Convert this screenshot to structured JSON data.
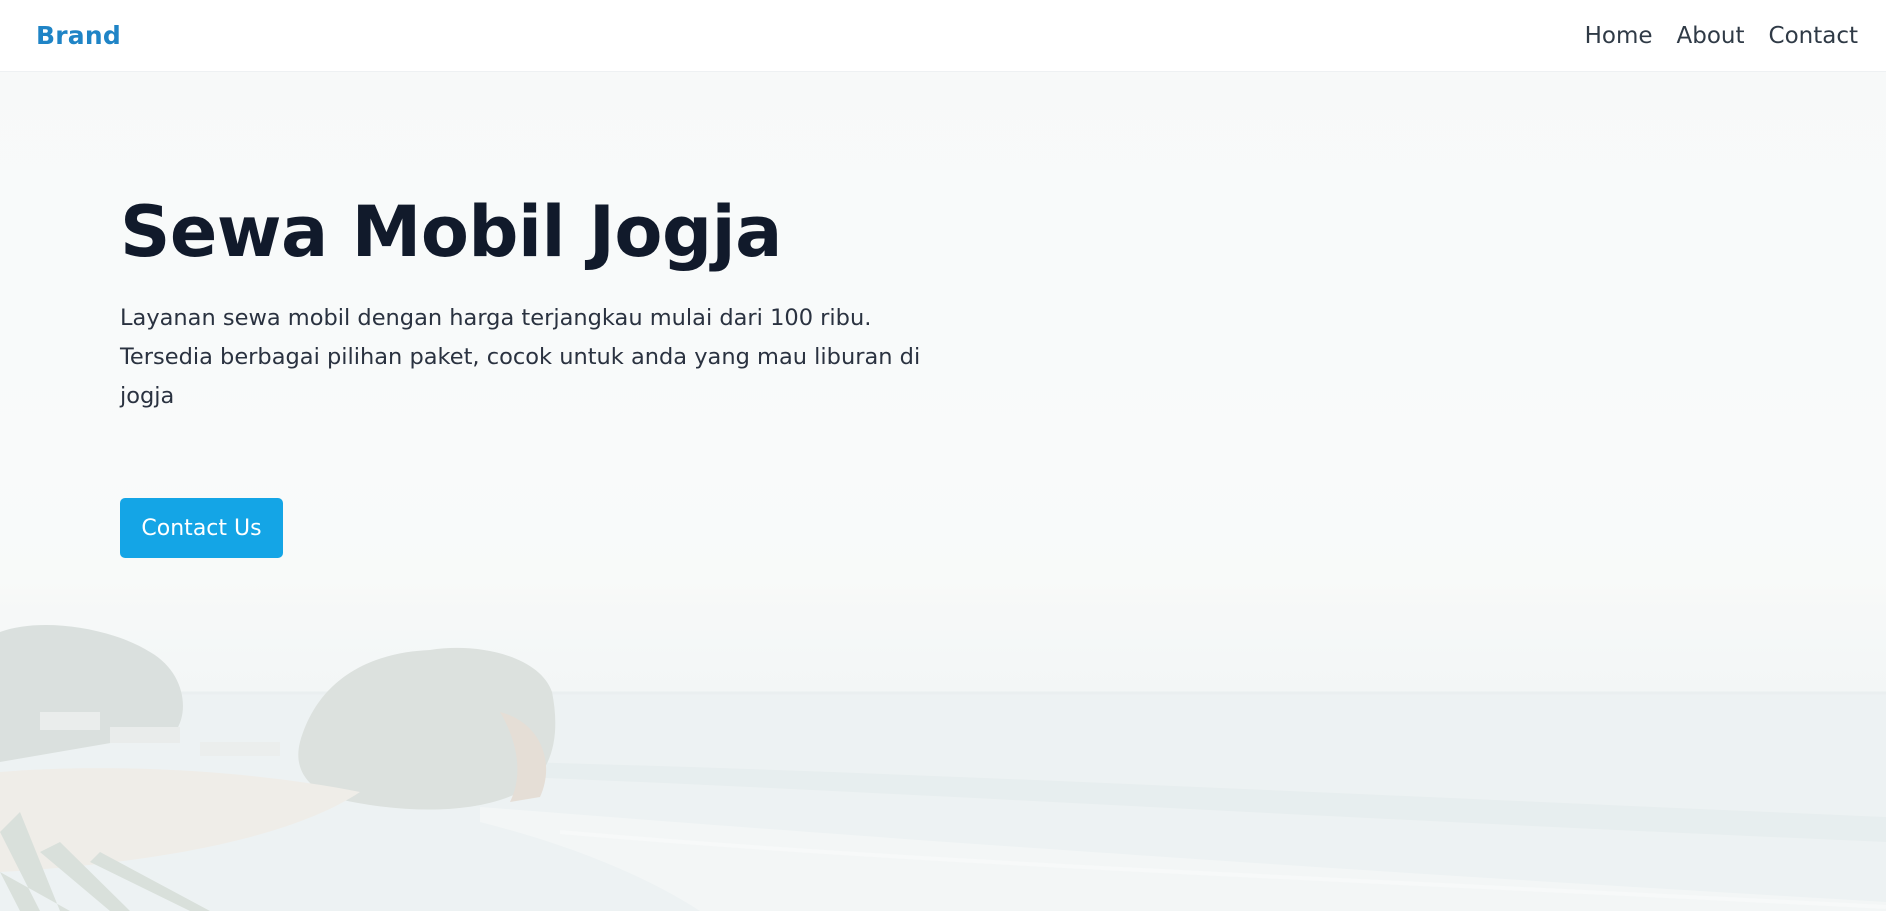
{
  "nav": {
    "brand": "Brand",
    "links": [
      "Home",
      "About",
      "Contact"
    ]
  },
  "hero": {
    "title": "Sewa Mobil Jogja",
    "description": "Layanan sewa mobil dengan harga terjangkau mulai dari 100 ribu. Tersedia berbagai pilihan paket, cocok untuk anda yang mau liburan di jogja",
    "cta_label": "Contact Us"
  },
  "colors": {
    "brand": "#1f84c6",
    "cta": "#14a5e6",
    "title": "#111a2b"
  }
}
